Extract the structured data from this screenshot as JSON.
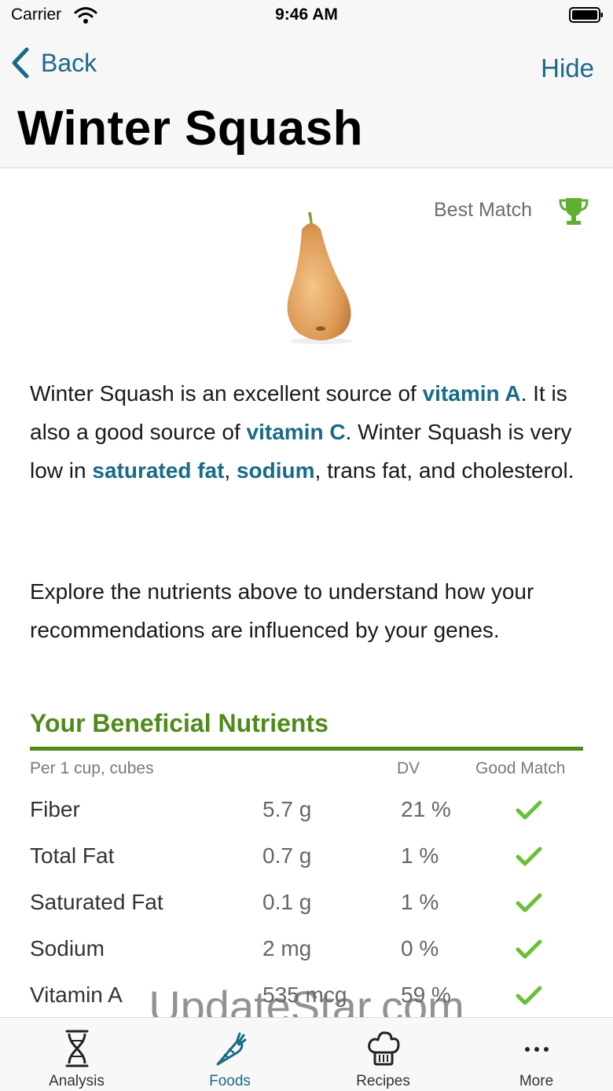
{
  "status_bar": {
    "carrier": "Carrier",
    "time": "9:46 AM"
  },
  "header": {
    "back_label": "Back",
    "hide_label": "Hide",
    "title": "Winter Squash"
  },
  "food": {
    "badge": "Best Match",
    "badge_icon": "trophy-icon",
    "image": "butternut-squash"
  },
  "description": {
    "t1": "Winter Squash is an excellent source of ",
    "l1": "vitamin A",
    "t2": ". It is also a good source of ",
    "l2": "vitamin C",
    "t3": ". Winter Squash is very low in ",
    "l3": "saturated fat",
    "t4": ", ",
    "l4": "sodium",
    "t5": ", trans fat, and cholesterol."
  },
  "explore": "Explore the nutrients above to understand how your recommendations are influenced by your genes.",
  "nutrients": {
    "title": "Your Beneficial Nutrients",
    "header": {
      "per": "Per 1 cup, cubes",
      "dv": "DV",
      "good": "Good Match"
    },
    "rows": [
      {
        "name": "Fiber",
        "amount": "5.7 g",
        "dv": "21 %"
      },
      {
        "name": "Total Fat",
        "amount": "0.7 g",
        "dv": "1 %"
      },
      {
        "name": "Saturated Fat",
        "amount": "0.1 g",
        "dv": "1 %"
      },
      {
        "name": "Sodium",
        "amount": "2 mg",
        "dv": "0 %"
      },
      {
        "name": "Vitamin A",
        "amount": "535 mcg",
        "dv": "59 %"
      }
    ]
  },
  "watermark": "UpdateStar.com",
  "tabs": [
    {
      "label": "Analysis",
      "icon": "dna-icon",
      "active": false
    },
    {
      "label": "Foods",
      "icon": "carrot-icon",
      "active": true
    },
    {
      "label": "Recipes",
      "icon": "chef-hat-icon",
      "active": false
    },
    {
      "label": "More",
      "icon": "more-dots-icon",
      "active": false
    }
  ],
  "colors": {
    "link": "#1a6a8a",
    "accent_green": "#4f8a1a",
    "check_green": "#6cbf3a"
  }
}
